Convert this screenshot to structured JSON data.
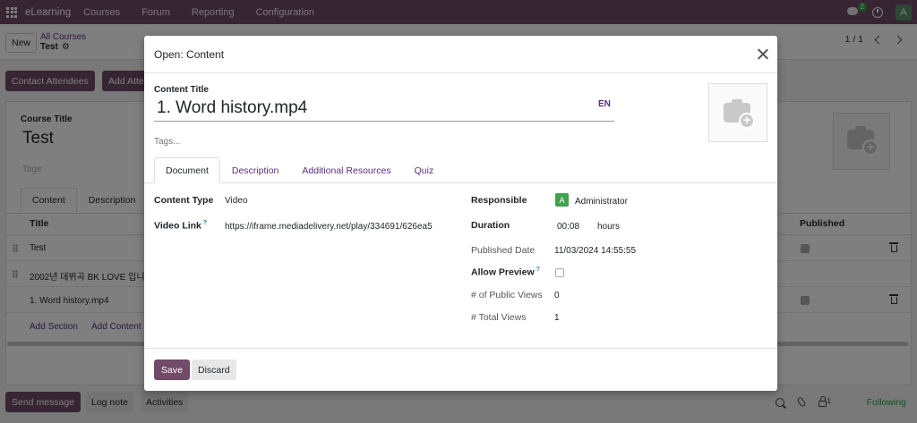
{
  "navbar": {
    "brand": "eLearning",
    "menu": [
      "Courses",
      "Forum",
      "Reporting",
      "Configuration"
    ],
    "chat_count": "2",
    "avatar_letter": "A"
  },
  "control_panel": {
    "new_label": "New",
    "breadcrumb_parent": "All Courses",
    "breadcrumb_current": "Test",
    "pager": "1 / 1"
  },
  "background": {
    "contact_label": "Contact Attendees",
    "add_label": "Add Attendees",
    "course_title_label": "Course Title",
    "course_title": "Test",
    "tags_placeholder": "Tags",
    "tabs": [
      "Content",
      "Description"
    ],
    "table": {
      "col_title": "Title",
      "col_published": "Published",
      "rows": [
        "Test",
        "2002년 데뷔곡 BK LOVE 입니",
        "1. Word history.mp4"
      ]
    },
    "add_section": "Add Section",
    "add_content": "Add Content"
  },
  "chatter": {
    "send_message": "Send message",
    "log_note": "Log note",
    "activities": "Activities",
    "followers_count": "1",
    "following": "Following"
  },
  "modal": {
    "title": "Open: Content",
    "content_title_label": "Content Title",
    "content_title_value": "1. Word history.mp4",
    "lang": "EN",
    "tags_placeholder": "Tags...",
    "tabs": [
      "Document",
      "Description",
      "Additional Resources",
      "Quiz"
    ],
    "fields": {
      "content_type_label": "Content Type",
      "content_type_value": "Video",
      "video_link_label": "Video Link",
      "video_link_help": "?",
      "video_link_value": "https://iframe.mediadelivery.net/play/334691/626ea5",
      "responsible_label": "Responsible",
      "responsible_avatar": "A",
      "responsible_value": "Administrator",
      "duration_label": "Duration",
      "duration_value": "00:08",
      "duration_unit": "hours",
      "published_date_label": "Published Date",
      "published_date_value": "11/03/2024 14:55:55",
      "allow_preview_label": "Allow Preview",
      "allow_preview_help": "?",
      "public_views_label": "# of Public Views",
      "public_views_value": "0",
      "total_views_label": "# Total Views",
      "total_views_value": "1"
    },
    "save_label": "Save",
    "discard_label": "Discard"
  }
}
